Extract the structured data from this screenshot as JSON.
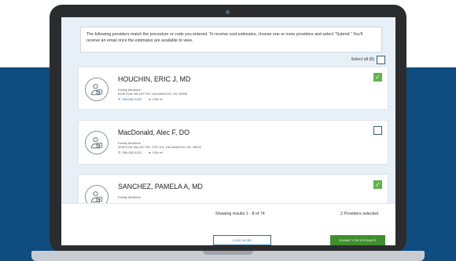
{
  "intro": {
    "text": "The following providers match the procedure or code you entered. To receive cost estimates, choose one or more providers and select \"Submit.\" You'll receive an email once the estimates are available to view."
  },
  "select_all": {
    "label": "Select all (8)",
    "checked": false
  },
  "providers": [
    {
      "name": "HOUCHIN, ERIC J, MD",
      "specialty": "Family Medicine",
      "address": "6938 ELM VALLEY DR, KALAMAZOO, MI, 49009",
      "phone": "269-552-4223",
      "distance": "0.56 mi",
      "checked": true
    },
    {
      "name": "MacDonald, Alec F, DO",
      "specialty": "Family Medicine",
      "address": "6938 ELM VALLEY DR, STE 101, KALAMAZOO, MI, 49009",
      "phone": "269-552-4223",
      "distance": "0.56 mi",
      "checked": false
    },
    {
      "name": "SANCHEZ, PAMELA A, MD",
      "specialty": "Family Medicine",
      "address": "",
      "phone": "",
      "distance": "",
      "checked": true
    }
  ],
  "footer": {
    "results_text": "Showing results 1 - 8 of 74",
    "load_more_label": "LOAD MORE",
    "providers_selected": "2 Providers selected",
    "submit_label": "SUBMIT FOR ESTIMATE"
  },
  "colors": {
    "background_band": "#0f4d80",
    "screen_bg": "#e7f0f7",
    "checked_green": "#62b14e",
    "submit_green": "#3f8f2c",
    "link_blue": "#1f5f92"
  }
}
